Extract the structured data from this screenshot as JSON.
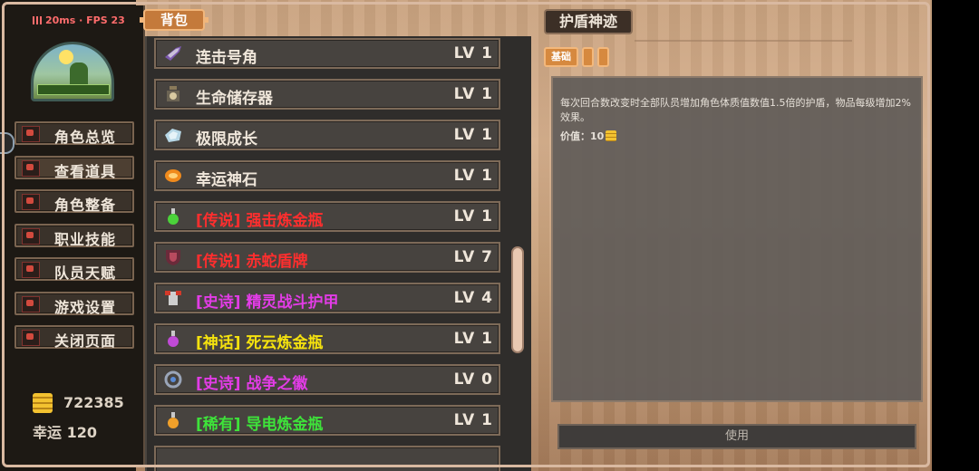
{
  "status": {
    "latency": "20ms",
    "fps_label": "FPS 23"
  },
  "sidebar": {
    "menu": [
      {
        "label": "角色总览"
      },
      {
        "label": "查看道具"
      },
      {
        "label": "角色整备"
      },
      {
        "label": "职业技能"
      },
      {
        "label": "队员天赋"
      },
      {
        "label": "游戏设置"
      },
      {
        "label": "关闭页面"
      }
    ],
    "gold": "722385",
    "luck": "幸运 120"
  },
  "bag": {
    "title": "背包",
    "items": [
      {
        "name": "连击号角",
        "level": "LV 1",
        "color": "#efe6da",
        "icon": "horn-icon"
      },
      {
        "name": "生命储存器",
        "level": "LV 1",
        "color": "#efe6da",
        "icon": "life-jar-icon"
      },
      {
        "name": "极限成长",
        "level": "LV 1",
        "color": "#efe6da",
        "icon": "crystal-icon"
      },
      {
        "name": "幸运神石",
        "level": "LV 1",
        "color": "#efe6da",
        "icon": "lucky-stone-icon"
      },
      {
        "name": "[传说] 强击炼金瓶",
        "level": "LV 1",
        "color": "#ff2e2e",
        "icon": "green-flask-icon"
      },
      {
        "name": "[传说] 赤蛇盾牌",
        "level": "LV 7",
        "color": "#ff2e2e",
        "icon": "shield-icon"
      },
      {
        "name": "[史诗] 精灵战斗护甲",
        "level": "LV 4",
        "color": "#e23ce6",
        "icon": "armor-icon"
      },
      {
        "name": "[神话] 死云炼金瓶",
        "level": "LV 1",
        "color": "#f5e20e",
        "icon": "purple-flask-icon"
      },
      {
        "name": "[史诗] 战争之徽",
        "level": "LV 0",
        "color": "#e23ce6",
        "icon": "war-emblem-icon"
      },
      {
        "name": "[稀有] 导电炼金瓶",
        "level": "LV 1",
        "color": "#3ee23a",
        "icon": "orange-flask-icon"
      }
    ]
  },
  "detail": {
    "title": "护盾神迹",
    "tag": "基础",
    "description": "每次回合数改变时全部队员增加角色体质值数值1.5倍的护盾，物品每级增加2%效果。",
    "value": "价值：10",
    "use_button": "使用"
  }
}
